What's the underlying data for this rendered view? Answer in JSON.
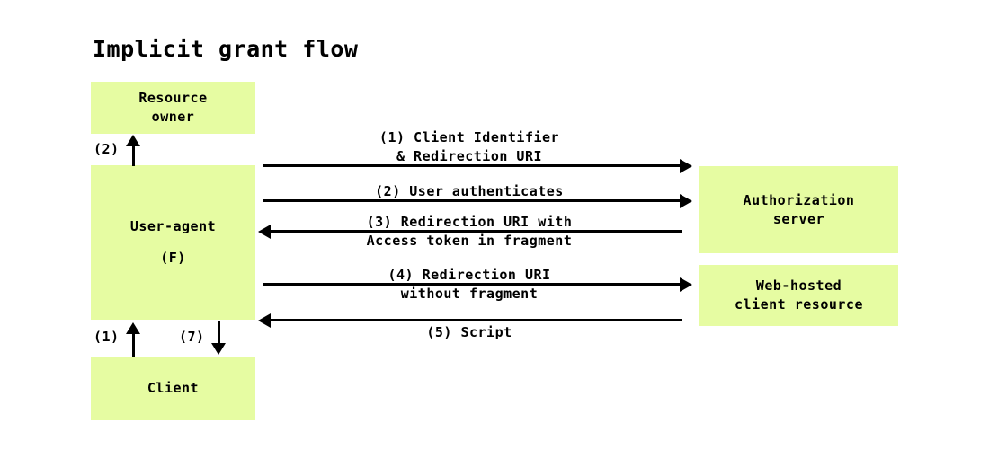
{
  "diagram": {
    "title": "Implicit grant flow",
    "colors": {
      "box_fill": "#e6fca2",
      "stroke": "#000000",
      "background": "#ffffff",
      "text": "#000000"
    },
    "nodes": {
      "resource_owner": {
        "line1": "Resource",
        "line2": "owner"
      },
      "user_agent": {
        "line1": "User-agent",
        "line2": "(F)"
      },
      "client": {
        "line1": "Client",
        "line2": ""
      },
      "auth_server": {
        "line1": "Authorization",
        "line2": "server"
      },
      "web_hosted": {
        "line1": "Web-hosted",
        "line2": "client resource"
      }
    },
    "messages": [
      {
        "id": "m1",
        "line1": "(1) Client Identifier",
        "line2": "& Redirection URI",
        "direction": "right",
        "from": "user-agent",
        "to": "authorization-server"
      },
      {
        "id": "m2",
        "line1": "(2) User authenticates",
        "line2": "",
        "direction": "right",
        "from": "user-agent",
        "to": "authorization-server"
      },
      {
        "id": "m3",
        "line1": "(3) Redirection URI with",
        "line2": "Access token in fragment",
        "direction": "left",
        "from": "authorization-server",
        "to": "user-agent"
      },
      {
        "id": "m4",
        "line1": "(4) Redirection URI",
        "line2": "without fragment",
        "direction": "right",
        "from": "user-agent",
        "to": "web-hosted-client-resource"
      },
      {
        "id": "m5",
        "line1": "(5) Script",
        "line2": "",
        "direction": "left",
        "from": "web-hosted-client-resource",
        "to": "user-agent"
      }
    ],
    "vertical_arrows": [
      {
        "id": "v2",
        "label": "(2)",
        "direction": "up",
        "from": "user-agent",
        "to": "resource-owner"
      },
      {
        "id": "v1",
        "label": "(1)",
        "direction": "up",
        "from": "client",
        "to": "user-agent"
      },
      {
        "id": "v7",
        "label": "(7)",
        "direction": "down",
        "from": "user-agent",
        "to": "client"
      }
    ]
  }
}
